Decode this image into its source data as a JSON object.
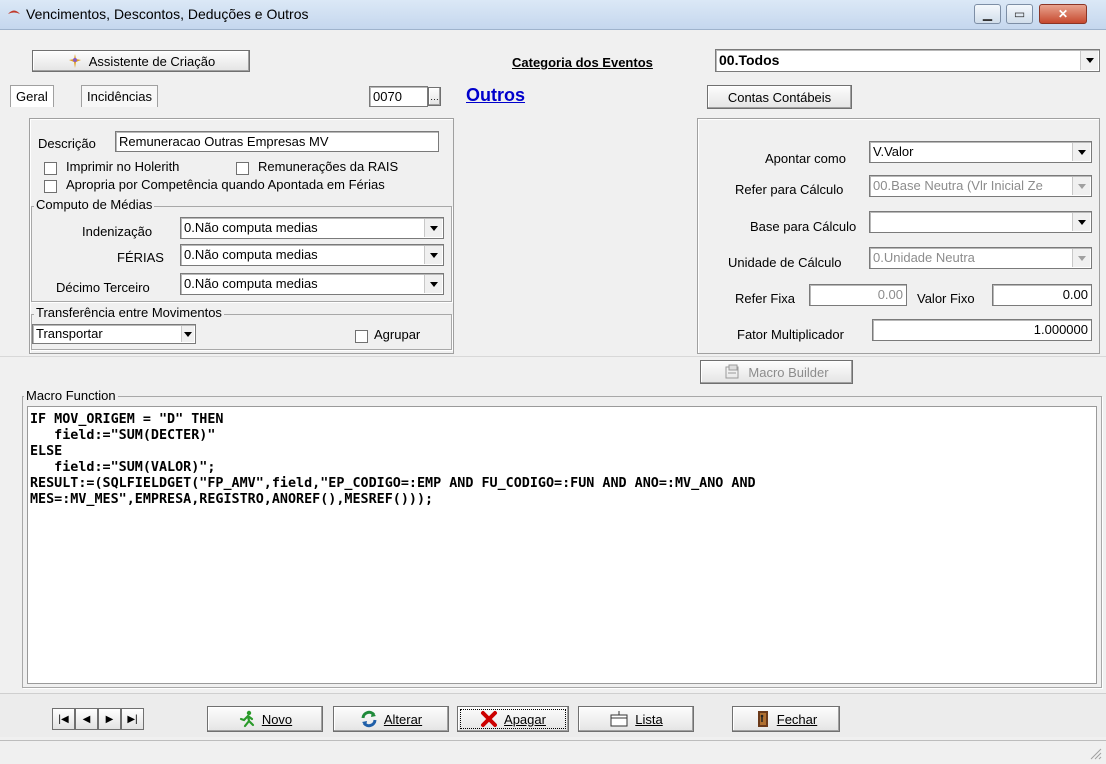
{
  "window": {
    "title": "Vencimentos, Descontos, Deduções e Outros"
  },
  "toolbar": {
    "wizard_label": "Assistente de Criação",
    "category_label": "Categoria dos Eventos",
    "category_value": "00.Todos"
  },
  "tabs": {
    "geral": "Geral",
    "incidencias": "Incidências"
  },
  "event": {
    "code": "0070",
    "name": "Outros"
  },
  "contas_label": "Contas Contábeis",
  "left": {
    "descricao_label": "Descrição",
    "descricao_value": "Remuneracao Outras Empresas MV",
    "imprimir_label": "Imprimir no Holerith",
    "rais_label": "Remunerações da RAIS",
    "apropria_label": "Apropria por Competência quando Apontada em Férias",
    "medias": {
      "title": "Computo de Médias",
      "indenizacao_label": "Indenização",
      "indenizacao_value": "0.Não computa medias",
      "ferias_label": "FÉRIAS",
      "ferias_value": "0.Não computa medias",
      "decimo_label": "Décimo Terceiro",
      "decimo_value": "0.Não computa medias"
    },
    "transferencia": {
      "title": "Transferência entre Movimentos",
      "value": "Transportar",
      "agrupar_label": "Agrupar"
    }
  },
  "right": {
    "apontar_label": "Apontar como",
    "apontar_value": "V.Valor",
    "refer_calc_label": "Refer para Cálculo",
    "refer_calc_value": "00.Base Neutra (Vlr Inicial Ze",
    "base_calc_label": "Base para Cálculo",
    "base_calc_value": "",
    "unidade_label": "Unidade de Cálculo",
    "unidade_value": "0.Unidade Neutra",
    "refer_fixa_label": "Refer Fixa",
    "refer_fixa_value": "0.00",
    "valor_fixo_label": "Valor Fixo",
    "valor_fixo_value": "0.00",
    "fator_label": "Fator Multiplicador",
    "fator_value": "1.000000"
  },
  "macro_builder_label": "Macro Builder",
  "macro": {
    "title": "Macro Function",
    "code": "IF MOV_ORIGEM = \"D\" THEN\n   field:=\"SUM(DECTER)\"\nELSE\n   field:=\"SUM(VALOR)\";\nRESULT:=(SQLFIELDGET(\"FP_AMV\",field,\"EP_CODIGO=:EMP AND FU_CODIGO=:FUN AND ANO=:MV_ANO AND\nMES=:MV_MES\",EMPRESA,REGISTRO,ANOREF(),MESREF()));"
  },
  "bottom": {
    "novo": "Novo",
    "alterar": "Alterar",
    "apagar": "Apagar",
    "lista": "Lista",
    "fechar": "Fechar"
  },
  "colors": {
    "link": "#0000cc",
    "apagar_x": "#cc0000",
    "novo_figure": "#2a9a2a"
  }
}
